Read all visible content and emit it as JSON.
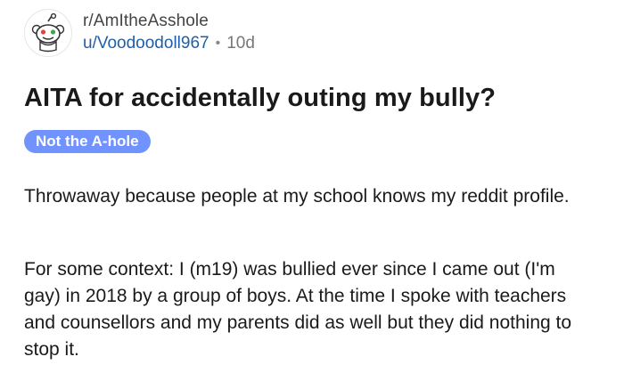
{
  "post": {
    "subreddit": "r/AmItheAsshole",
    "username": "u/Voodoodoll967",
    "separator": "•",
    "age": "10d",
    "avatar_icon": "snoo-avatar-icon",
    "title": "AITA for accidentally outing my bully?",
    "flair": {
      "label": "Not the A-hole",
      "color": "#7193ff"
    },
    "body": [
      "Throwaway because people at my school knows my reddit profile.",
      "For some context: I (m19) was bullied ever since I came out (I'm gay) in 2018 by a group of boys. At the time I spoke with teachers and counsellors and my parents did as well but they did nothing to stop it."
    ]
  },
  "colors": {
    "username": "#1f5fa8",
    "text": "#1a1a1b",
    "meta": "#777777"
  }
}
